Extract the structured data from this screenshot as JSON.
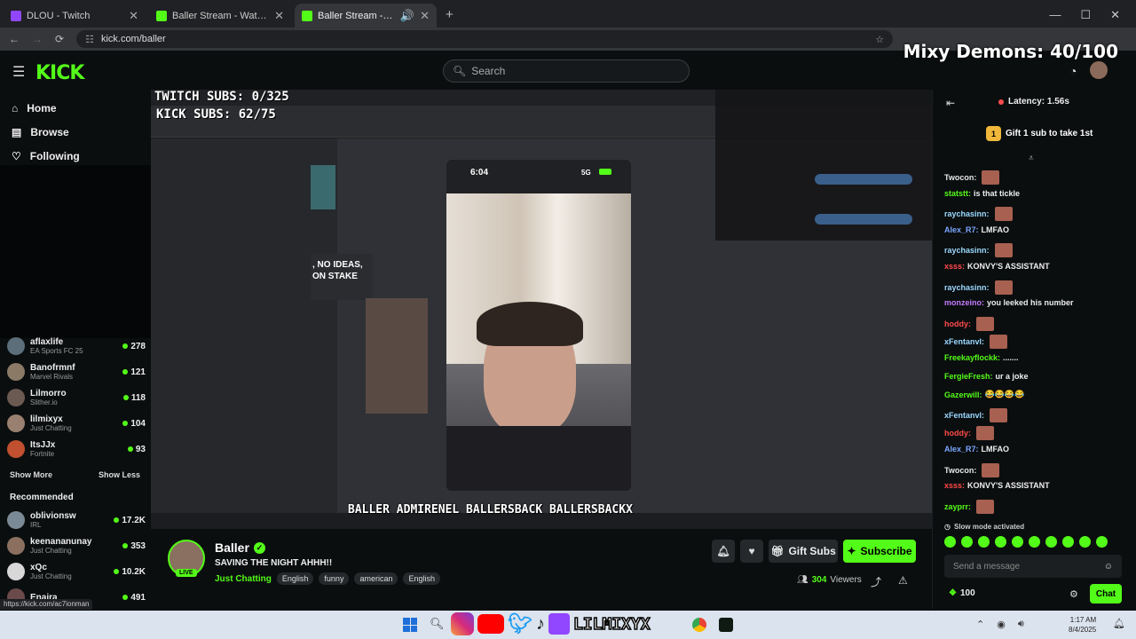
{
  "browser": {
    "tabs": [
      {
        "label": "DLOU - Twitch",
        "color": "#9146ff",
        "active": false
      },
      {
        "label": "Baller Stream - Watch Live on Kick",
        "color": "#53fc18",
        "active": false
      },
      {
        "label": "Baller Stream - Watch Live on Kick",
        "color": "#53fc18",
        "active": true
      }
    ],
    "url": "kick.com/baller",
    "status_url": "https://kick.com/ac7ionman"
  },
  "overlay": {
    "mixy": "Mixy Demons: 40/100",
    "twitch_subs": "TWITCH SUBS: 0/325",
    "kick_subs": "KICK SUBS: 62/75",
    "socials": "BALLER  ADMIRENEL  BALLERSBACK  BALLERSBACKX",
    "taskbar_handle": "LILMIXYX"
  },
  "header": {
    "logo": "KICK",
    "search_placeholder": "Search"
  },
  "sidebar": {
    "nav": [
      {
        "label": "Home"
      },
      {
        "label": "Browse"
      },
      {
        "label": "Following"
      }
    ],
    "following": [
      {
        "name": "aflaxlife",
        "category": "EA Sports FC 25",
        "viewers": "278"
      },
      {
        "name": "Banofrmnf",
        "category": "Marvel Rivals",
        "viewers": "121"
      },
      {
        "name": "Lilmorro",
        "category": "Slither.io",
        "viewers": "118"
      },
      {
        "name": "lilmixyx",
        "category": "Just Chatting",
        "viewers": "104"
      },
      {
        "name": "ItsJJx",
        "category": "Fortnite",
        "viewers": "93"
      }
    ],
    "show_more": "Show More",
    "show_less": "Show Less",
    "recommended_title": "Recommended",
    "recommended": [
      {
        "name": "oblivionsw",
        "category": "IRL",
        "viewers": "17.2K"
      },
      {
        "name": "keenananunay",
        "category": "Just Chatting",
        "viewers": "353"
      },
      {
        "name": "xQc",
        "category": "Just Chatting",
        "viewers": "10.2K"
      },
      {
        "name": "Enaira",
        "category": "",
        "viewers": "491"
      }
    ]
  },
  "stream_overlay": {
    "phone_time": "6:04",
    "phone_signal": "5G",
    "text_fragment_1": ", NO IDEAS,",
    "text_fragment_2": "ON STAKE"
  },
  "streamer": {
    "name": "Baller",
    "title": "SAVING THE NIGHT AHHH!!",
    "category": "Just Chatting",
    "tags": [
      "English",
      "funny",
      "american",
      "English"
    ],
    "live_label": "LIVE",
    "viewers": "304",
    "viewers_label": "Viewers",
    "gift_label": "Gift Subs",
    "subscribe_label": "Subscribe"
  },
  "chat": {
    "latency": "Latency: 1.56s",
    "gift_promo": "Gift 1 sub to take 1st",
    "gift_count": "1",
    "messages": [
      {
        "user": "Twocon:",
        "text": "",
        "color": "#e8e8e8"
      },
      {
        "user": "statstt:",
        "text": "is that tickle",
        "color": "#53fc18"
      },
      {
        "user": "raychasinn:",
        "text": "",
        "color": "#9ad8ff"
      },
      {
        "user": "Alex_R7:",
        "text": "LMFAO",
        "color": "#7aa7ff"
      },
      {
        "user": "raychasinn:",
        "text": "",
        "color": "#9ad8ff"
      },
      {
        "user": "xsss:",
        "text": "KONVY'S ASSISTANT",
        "color": "#ff4a4a"
      },
      {
        "user": "raychasinn:",
        "text": "",
        "color": "#9ad8ff"
      },
      {
        "user": "monzeino:",
        "text": "you leeked his number",
        "color": "#c27aff"
      },
      {
        "user": "hoddy:",
        "text": "",
        "color": "#ff4a4a"
      },
      {
        "user": "xFentanvl:",
        "text": "",
        "color": "#9ad8ff"
      },
      {
        "user": "Freekayflockk:",
        "text": ".......",
        "color": "#53fc18"
      },
      {
        "user": "FergieFresh:",
        "text": "ur a joke",
        "color": "#53fc18"
      },
      {
        "user": "Gazerwill:",
        "text": "😂😂😂😂",
        "color": "#53fc18"
      },
      {
        "user": "xFentanvl:",
        "text": "",
        "color": "#9ad8ff"
      },
      {
        "user": "hoddy:",
        "text": "",
        "color": "#ff4a4a"
      },
      {
        "user": "Alex_R7:",
        "text": "LMFAO",
        "color": "#7aa7ff"
      },
      {
        "user": "Twocon:",
        "text": "",
        "color": "#e8e8e8"
      },
      {
        "user": "xsss:",
        "text": "KONVY'S ASSISTANT",
        "color": "#ff4a4a"
      },
      {
        "user": "zayprr:",
        "text": "",
        "color": "#53fc18"
      }
    ],
    "slow_mode": "Slow mode activated",
    "input_placeholder": "Send a message",
    "points": "100",
    "send_label": "Chat"
  },
  "taskbar": {
    "time": "1:17 AM",
    "date": "8/4/2025"
  },
  "colors": {
    "accent": "#53fc18",
    "bg": "#0b0e0f"
  }
}
